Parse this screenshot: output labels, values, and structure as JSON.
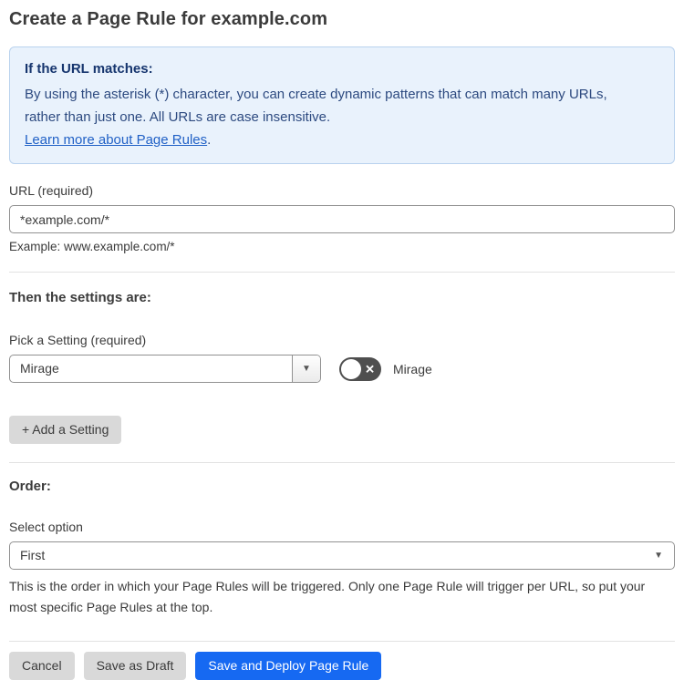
{
  "page": {
    "title": "Create a Page Rule for example.com"
  },
  "info_box": {
    "heading": "If the URL matches:",
    "body": "By using the asterisk (*) character, you can create dynamic patterns that can match many URLs, rather than just one. All URLs are case insensitive.",
    "link_label": "Learn more about Page Rules",
    "link_suffix": ".",
    "background_color": "#e9f2fc",
    "border_color": "#b9d2ee",
    "heading_color": "#16356e",
    "link_color": "#2161c6"
  },
  "url_field": {
    "label": "URL (required)",
    "value": "*example.com/*",
    "helper": "Example: www.example.com/*"
  },
  "settings_section": {
    "heading": "Then the settings are:",
    "pick_label": "Pick a Setting (required)",
    "selected_setting": "Mirage",
    "select_caret_icon": "▼",
    "toggle": {
      "state": "off",
      "off_icon": "✕",
      "label": "Mirage"
    },
    "add_setting_label": "+ Add a Setting"
  },
  "order_section": {
    "heading": "Order:",
    "select_label": "Select option",
    "selected_option": "First",
    "select_caret_icon": "▼",
    "helper": "This is the order in which your Page Rules will be triggered. Only one Page Rule will trigger per URL, so put your most specific Page Rules at the top."
  },
  "footer": {
    "cancel_label": "Cancel",
    "save_draft_label": "Save as Draft",
    "save_deploy_label": "Save and Deploy Page Rule",
    "primary_button_color": "#1669f2"
  }
}
